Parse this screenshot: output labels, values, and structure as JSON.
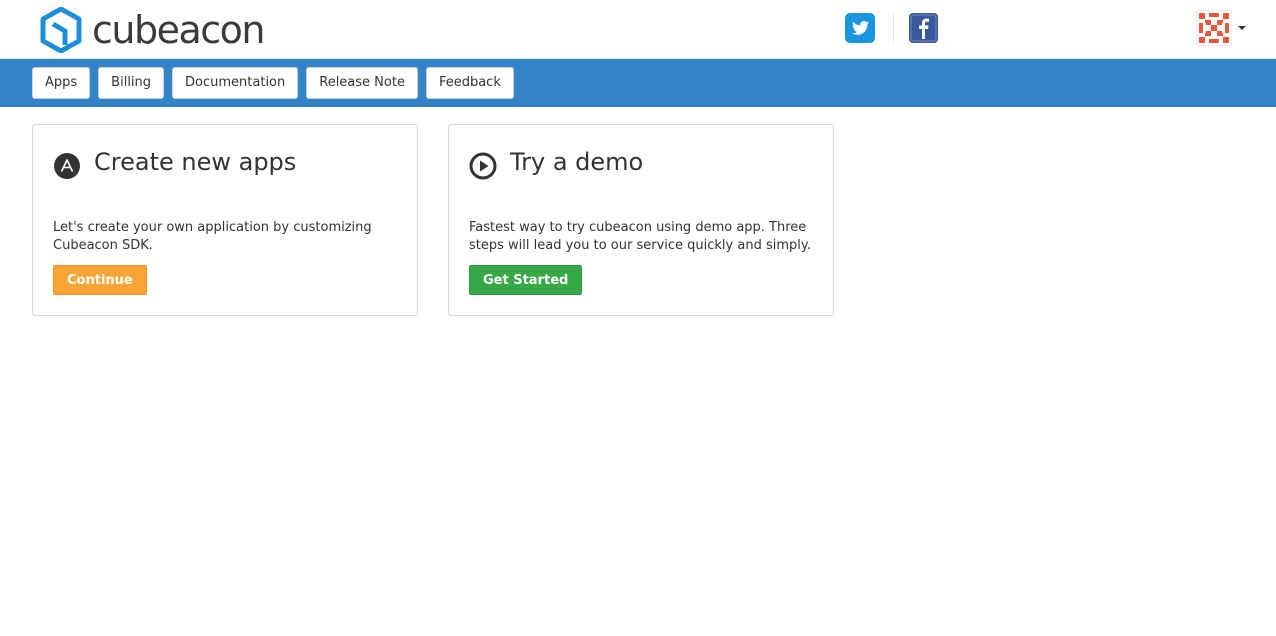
{
  "header": {
    "brand": "cubeacon",
    "brand_color": "#1d8fd8",
    "social": [
      {
        "icon": "twitter-icon",
        "color": "#1b95e0"
      },
      {
        "icon": "facebook-icon",
        "color": "#3b5998"
      }
    ],
    "user_menu": {
      "icon": "user-avatar",
      "caret": "caret-down-icon"
    }
  },
  "nav": {
    "color": "#3283c8",
    "items": [
      {
        "label": "Apps"
      },
      {
        "label": "Billing"
      },
      {
        "label": "Documentation"
      },
      {
        "label": "Release Note"
      },
      {
        "label": "Feedback"
      }
    ]
  },
  "cards": [
    {
      "icon": "app-icon",
      "title": "Create new apps",
      "description": "Let's create your own application by customizing Cubeacon SDK.",
      "button": "Continue",
      "button_color": "#f7a535"
    },
    {
      "icon": "play-icon",
      "title": "Try a demo",
      "description": "Fastest way to try cubeacon using demo app. Three steps will lead you to our service quickly and simply.",
      "button": "Get Started",
      "button_color": "#37a848"
    }
  ]
}
